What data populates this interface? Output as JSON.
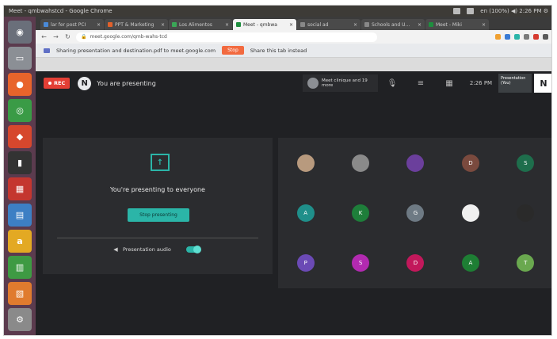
{
  "os": {
    "window_title": "Meet - qmbwahstcd - Google Chrome",
    "tray_text": "en  (100%) ◀)  2:26 PM  ⚙"
  },
  "launcher": [
    {
      "name": "dash-icon",
      "color": "#6a6f7a",
      "glyph": "◉"
    },
    {
      "name": "files-icon",
      "color": "#8b8f95",
      "glyph": "▭"
    },
    {
      "name": "firefox-icon",
      "color": "#e8642b",
      "glyph": "●"
    },
    {
      "name": "chrome-icon",
      "color": "#3a9b46",
      "glyph": "◎"
    },
    {
      "name": "software-center-icon",
      "color": "#d6472d",
      "glyph": "◆"
    },
    {
      "name": "terminal-icon",
      "color": "#333333",
      "glyph": "▮"
    },
    {
      "name": "app-grid-icon",
      "color": "#c4362f",
      "glyph": "▦"
    },
    {
      "name": "writer-icon",
      "color": "#3d7fc4",
      "glyph": "▤"
    },
    {
      "name": "amazon-icon",
      "color": "#e3a923",
      "glyph": "a"
    },
    {
      "name": "calc-icon",
      "color": "#3e9a43",
      "glyph": "▥"
    },
    {
      "name": "impress-icon",
      "color": "#e07b2e",
      "glyph": "▧"
    },
    {
      "name": "settings-icon",
      "color": "#8a8a8a",
      "glyph": "⚙"
    }
  ],
  "chrome": {
    "tabs": [
      {
        "label": "lar fer post PCI",
        "favicon": "#4a8ad8",
        "active": false
      },
      {
        "label": "PPT & Marketing",
        "favicon": "#e2612b",
        "active": false
      },
      {
        "label": "Los Alimentos",
        "favicon": "#3aa757",
        "active": false
      },
      {
        "label": "Meet - qmbwa",
        "favicon": "#1e8e3e",
        "active": true
      },
      {
        "label": "social ad",
        "favicon": "#888888",
        "active": false
      },
      {
        "label": "Schools and U...",
        "favicon": "#888888",
        "active": false
      },
      {
        "label": "Meet - Miki",
        "favicon": "#1e8e3e",
        "active": false
      }
    ],
    "url": "meet.google.com/qmb-wahs-tcd",
    "infobar_text": "Sharing presentation and destination.pdf to meet.google.com",
    "stop_label": "Stop",
    "hide_label": "Share this tab instead"
  },
  "meet": {
    "rec_label": "REC",
    "presenter_initial": "N",
    "presenting_label": "You are presenting",
    "host_chip": "Meet clinique and 19 more",
    "clock": "2:26 PM",
    "presentation_tile": "Presentation (You)",
    "self_initial": "N",
    "panel_message": "You're presenting to everyone",
    "stop_presenting": "Stop presenting",
    "audio_label": "Presentation audio",
    "audio_on": true
  },
  "participants": [
    {
      "initial": "",
      "color": "#b89a7e",
      "kind": "photo"
    },
    {
      "initial": "",
      "color": "#8a8a8a",
      "kind": "photo"
    },
    {
      "initial": "",
      "color": "#6b3f9c",
      "kind": "photo"
    },
    {
      "initial": "D",
      "color": "#7a4a3e",
      "kind": "letter"
    },
    {
      "initial": "S",
      "color": "#1e6e4c",
      "kind": "letter"
    },
    {
      "initial": "A",
      "color": "#1f8f8a",
      "kind": "letter"
    },
    {
      "initial": "K",
      "color": "#1e7e3a",
      "kind": "letter"
    },
    {
      "initial": "G",
      "color": "#6e7a84",
      "kind": "letter"
    },
    {
      "initial": "",
      "color": "#f0f0f0",
      "kind": "photo"
    },
    {
      "initial": "",
      "color": "#2a2a2a",
      "kind": "photo"
    },
    {
      "initial": "P",
      "color": "#6b4ab5",
      "kind": "letter"
    },
    {
      "initial": "S",
      "color": "#b22ab0",
      "kind": "letter"
    },
    {
      "initial": "D",
      "color": "#c2185b",
      "kind": "letter"
    },
    {
      "initial": "A",
      "color": "#1e7e34",
      "kind": "letter"
    },
    {
      "initial": "T",
      "color": "#6aa84f",
      "kind": "letter"
    }
  ]
}
